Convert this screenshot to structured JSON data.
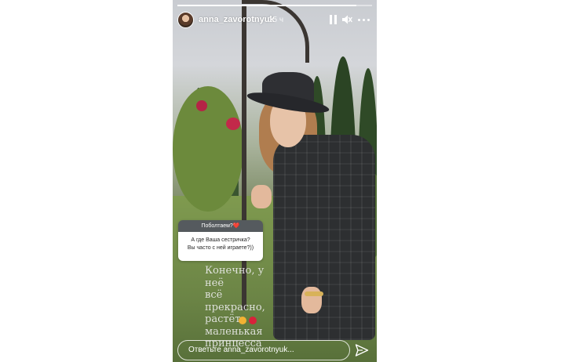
{
  "header": {
    "username": "anna_zavorotnyuk",
    "time": "15 ч",
    "progress": 0.92
  },
  "sticker": {
    "header": "Поболтаем?❤️",
    "question_line1": "А где Ваша сестричка?",
    "question_line2": "Вы часто с ней играете?))"
  },
  "caption": {
    "line1": "Конечно, у неё",
    "line2": "всё прекрасно,",
    "line3": "растёт",
    "line4": "маленькая",
    "line5": "принцесса"
  },
  "reply": {
    "placeholder": "Ответьте anna_zavorotnyuk..."
  },
  "icons": {
    "pause": "pause-icon",
    "mute": "mute-icon",
    "more": "more-icon",
    "send": "send-icon"
  },
  "colors": {
    "sticker_header_bg": "#555a5e",
    "text": "#ffffff"
  }
}
